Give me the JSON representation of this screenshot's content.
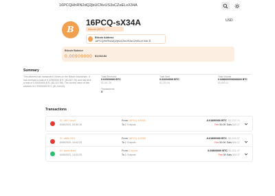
{
  "topbar": {
    "search_value": "16PCQHhRN2dQ2jbUCNvUS3sCZeELxX34A"
  },
  "wallet": {
    "avatar_glyph": "B",
    "name": "16PCQ-sX34A",
    "tag": "Bitcoin (BTC)",
    "currency": "USD"
  },
  "address": {
    "label": "Bitcoin Address",
    "value": "16PCQHhRN2dQ2jbUCNvUS3sCZeELxX34A"
  },
  "balance": {
    "label": "Bitcoin Balance",
    "value": "0.00900000",
    "fiat": "$1,044.84"
  },
  "summary": {
    "title": "Summary",
    "text": "This address has transacted 3 times on the Bitcoin blockchain. It has received a total of 0.02900000 BTC ($3,367.26) and has sent a total of 0.02000000 BTC ($2,321.96). The current value of this address is 0.00900000 BTC ($1,044.84).",
    "stats": [
      {
        "label": "Total Received",
        "value": "0.02900000 BTC",
        "sub": "$3,367.26"
      },
      {
        "label": "Total Sent",
        "value": "0.02000000 BTC",
        "sub": "$2,321.96"
      },
      {
        "label": "Total Volume",
        "value": "0.04900000000000000 BTC",
        "sub": "$5,689.22"
      },
      {
        "label": "Transactions",
        "value": "3",
        "sub": ""
      }
    ]
  },
  "transactions": {
    "title": "Transactions",
    "items": [
      {
        "id": "ID: df07-6ec9",
        "date": "6/06/2023, 03:50:18",
        "from_prefix": "From",
        "from": "16PCQ-sX34A",
        "to_prefix": "To",
        "to": "2 Outputs",
        "amount": "-0.01850000 BTC",
        "amount_fiat": "-$1,222.71",
        "fee_label": "Fee",
        "fee": "50.0K Sats",
        "fee_fiat": "$58.37",
        "color": "#e53935"
      },
      {
        "id": "ID: af66-0f15",
        "date": "6/06/2023, 14:02:20",
        "from_prefix": "From",
        "from": "16PCQ-sX34A",
        "to_prefix": "To",
        "to": "2 Outputs",
        "amount": "-0.01850000 BTC",
        "amount_fiat": "-$3,333.57",
        "fee_label": "Fee",
        "fee": "50.0K Sats",
        "fee_fiat": "$58.37",
        "color": "#e53935"
      },
      {
        "id": "ID: aae6-fbbd",
        "date": "6/06/2023, 14:02:20",
        "from_prefix": "From",
        "from": "2 Inputs",
        "to_prefix": "To",
        "to": "2 Outputs",
        "amount": "0.05800000 BTC",
        "amount_fiat": "$3,301.07",
        "fee_label": "Fee",
        "fee": "50 Sats",
        "fee_fiat": "$58.37",
        "color": "#2fbf71"
      }
    ]
  }
}
